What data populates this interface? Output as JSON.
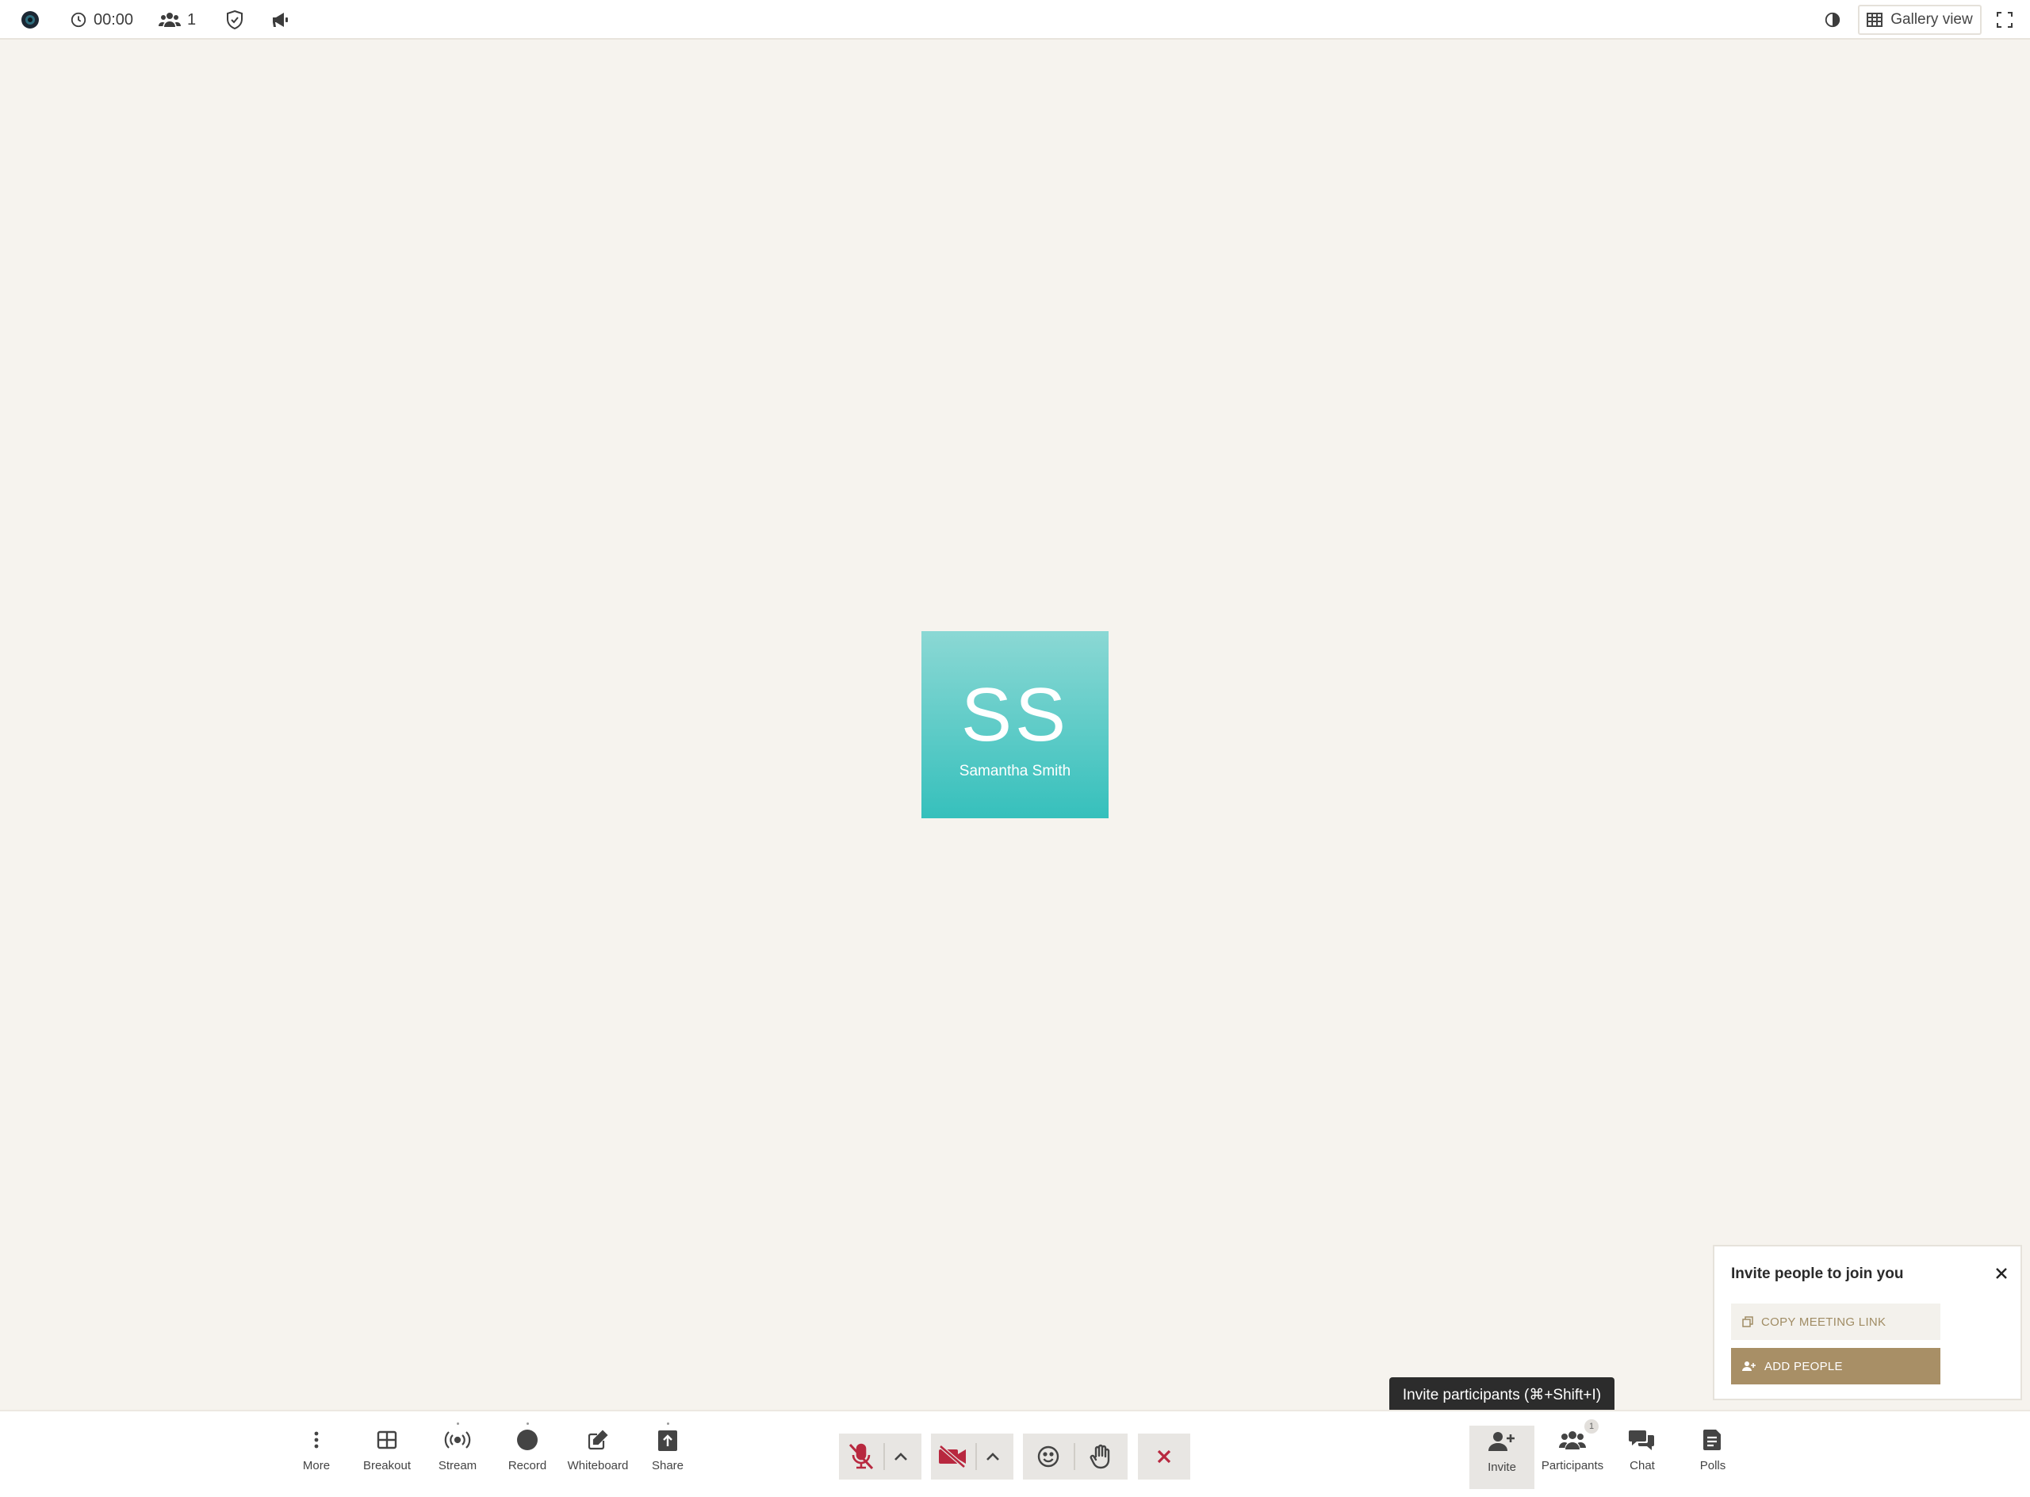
{
  "topbar": {
    "timer": "00:00",
    "participant_count": "1",
    "gallery_label": "Gallery view"
  },
  "stage": {
    "tile": {
      "initials": "SS",
      "name": "Samantha Smith",
      "color_top": "#8bd8d4",
      "color_bottom": "#36c0bc"
    }
  },
  "invite_panel": {
    "title": "Invite people to join you",
    "copy_link_label": "COPY MEETING LINK",
    "add_people_label": "ADD PEOPLE",
    "accent_color": "#a88f66"
  },
  "tooltip": {
    "text": "Invite participants (⌘+Shift+I)"
  },
  "toolbar": {
    "left_tools": [
      {
        "label": "More",
        "icon": "more-vertical-icon"
      },
      {
        "label": "Breakout",
        "icon": "grid-icon"
      },
      {
        "label": "Stream",
        "icon": "broadcast-icon"
      },
      {
        "label": "Record",
        "icon": "record-icon"
      },
      {
        "label": "Whiteboard",
        "icon": "edit-icon"
      },
      {
        "label": "Share",
        "icon": "share-upload-icon"
      }
    ],
    "center_controls": {
      "mic": {
        "icon": "mic-off-icon",
        "state": "muted"
      },
      "camera": {
        "icon": "video-off-icon",
        "state": "off"
      },
      "reactions": {
        "icon": "smiley-icon"
      },
      "raise_hand": {
        "icon": "hand-icon"
      },
      "leave": {
        "icon": "close-icon"
      },
      "off_color": "#b8283f"
    },
    "right_tools": [
      {
        "label": "Invite",
        "icon": "add-user-icon",
        "active": true
      },
      {
        "label": "Participants",
        "icon": "people-icon",
        "badge": "1"
      },
      {
        "label": "Chat",
        "icon": "chat-icon"
      },
      {
        "label": "Polls",
        "icon": "polls-icon"
      }
    ]
  }
}
